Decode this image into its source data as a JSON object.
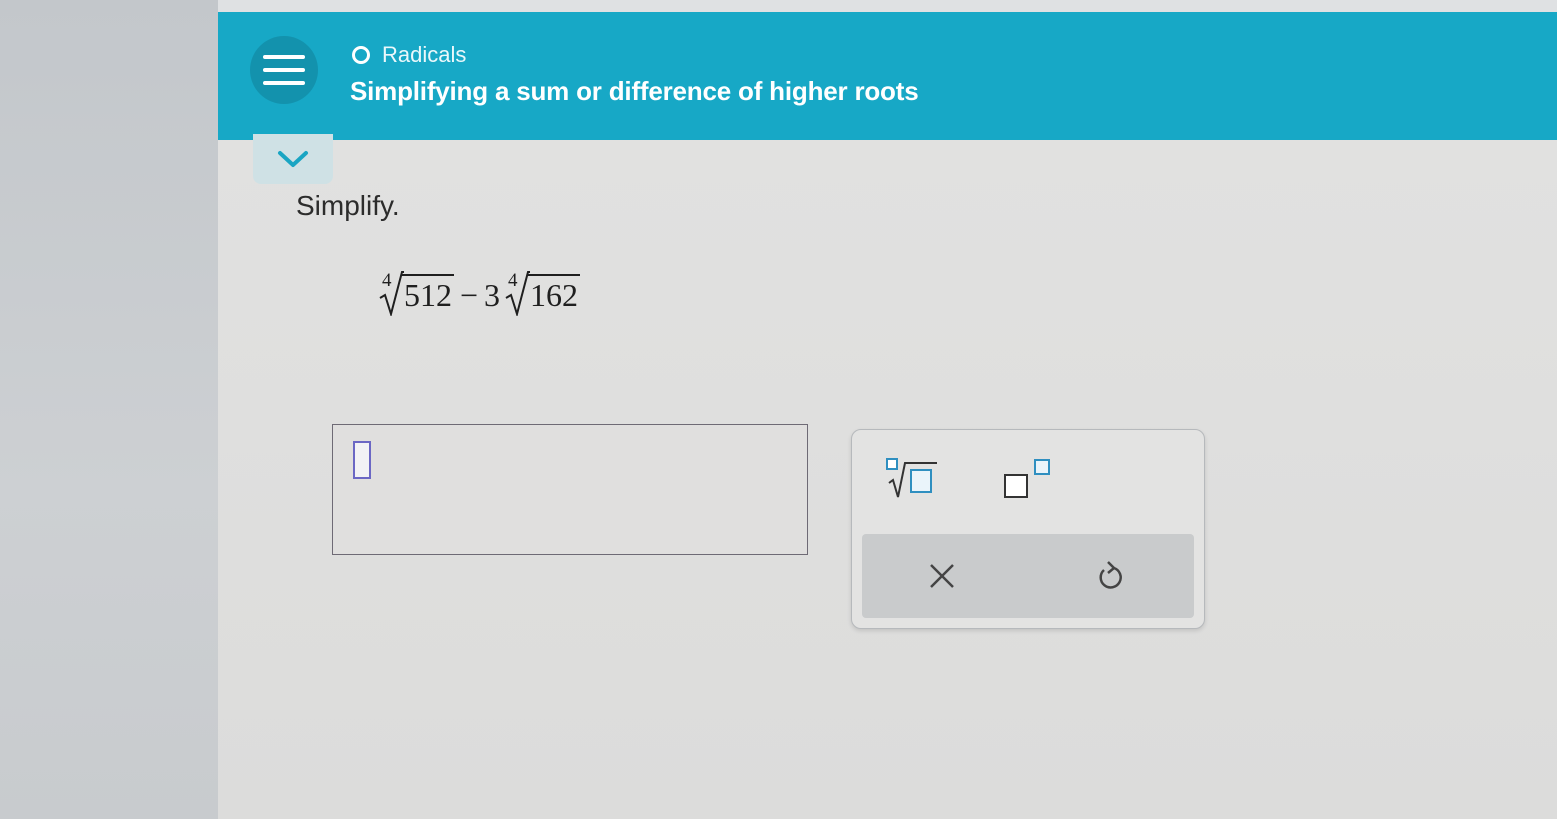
{
  "header": {
    "topic": "Radicals",
    "lesson_title": "Simplifying a sum or difference of higher roots"
  },
  "problem": {
    "instruction": "Simplify.",
    "expression": {
      "term1_index": "4",
      "term1_radicand": "512",
      "operator": "−",
      "term2_coefficient": "3",
      "term2_index": "4",
      "term2_radicand": "162"
    }
  },
  "palette": {
    "buttons": [
      "nth-root",
      "exponent",
      "clear",
      "undo"
    ]
  },
  "colors": {
    "header": "#17a8c6",
    "menu_button": "#1392ad",
    "cursor_box": "#6b67c4",
    "page_background": "#dedede"
  },
  "icons": {
    "menu": "hamburger-icon",
    "topic": "circle-outline-icon",
    "collapse": "chevron-down-icon",
    "root": "nth-root-template-icon",
    "exponent": "superscript-template-icon",
    "clear": "close-icon",
    "undo": "undo-icon"
  }
}
